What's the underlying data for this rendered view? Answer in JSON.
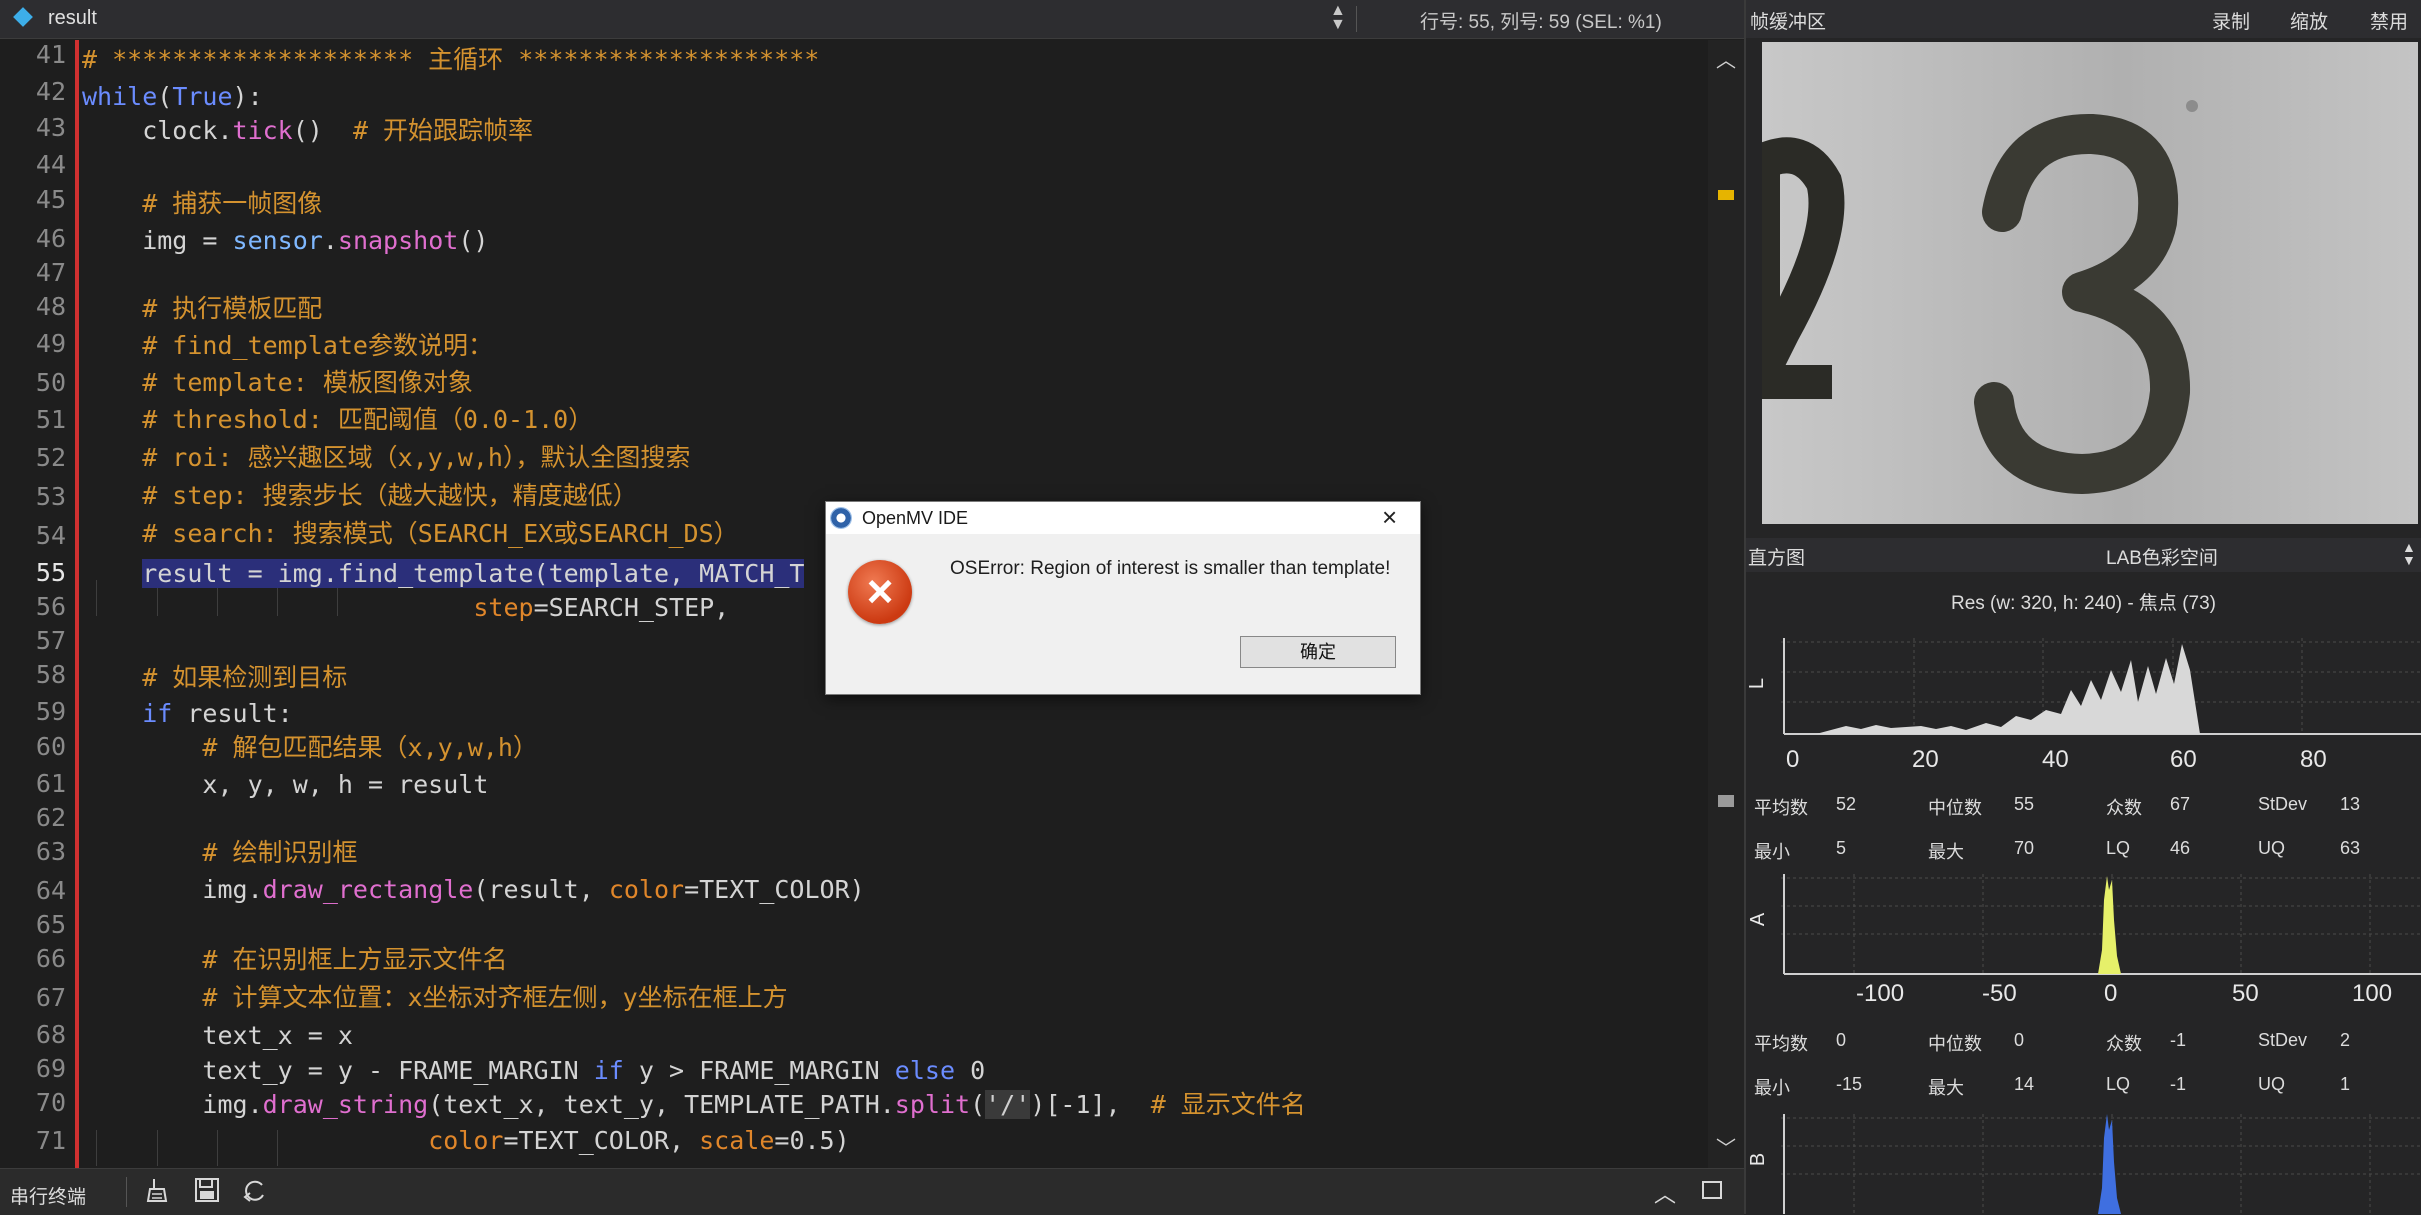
{
  "editor": {
    "tab_name": "result",
    "cursor_info": "行号: 55, 列号: 59   (SEL: %1)",
    "line_numbers": [
      "41",
      "42",
      "43",
      "44",
      "45",
      "46",
      "47",
      "48",
      "49",
      "50",
      "51",
      "52",
      "53",
      "54",
      "55",
      "56",
      "57",
      "58",
      "59",
      "60",
      "61",
      "62",
      "63",
      "64",
      "65",
      "66",
      "67",
      "68",
      "69",
      "70",
      "71"
    ],
    "current_line": "55",
    "lines": {
      "l41": "# ******************** 主循环 ********************",
      "l42_kw": "while",
      "l42_rest": "(",
      "l42_true": "True",
      "l42_end": "):",
      "l43_a": "    clock.",
      "l43_fn": "tick",
      "l43_b": "()  ",
      "l43_cm": "# 开始跟踪帧率",
      "l45": "    # 捕获一帧图像",
      "l46_a": "    img = ",
      "l46_ob": "sensor",
      "l46_dot": ".",
      "l46_fn": "snapshot",
      "l46_b": "()",
      "l48": "    # 执行模板匹配",
      "l49": "    # find_template参数说明：",
      "l50": "    # template: 模板图像对象",
      "l51": "    # threshold: 匹配阈值（0.0-1.0）",
      "l52": "    # roi: 感兴趣区域（x,y,w,h），默认全图搜索",
      "l53": "    # step: 搜索步长（越大越快，精度越低）",
      "l54": "    # search: 搜索模式（SEARCH_EX或SEARCH_DS）",
      "l55_indent": "    ",
      "l55_sel": "result = img.find_template(template, MATCH_T",
      "l56_indent": "                          ",
      "l56_pa": "step",
      "l56_rest": "=SEARCH_STEP,",
      "l58": "    # 如果检测到目标",
      "l59_kw": "if",
      "l59_a": "    ",
      "l59_b": " result:",
      "l60": "        # 解包匹配结果（x,y,w,h）",
      "l61": "        x, y, w, h = result",
      "l63": "        # 绘制识别框",
      "l64_a": "        img.",
      "l64_fn": "draw_rectangle",
      "l64_b": "(result, ",
      "l64_pa": "color",
      "l64_c": "=TEXT_COLOR)",
      "l66": "        # 在识别框上方显示文件名",
      "l67": "        # 计算文本位置：x坐标对齐框左侧，y坐标在框上方",
      "l68": "        text_x = x",
      "l69_a": "        text_y = y - FRAME_MARGIN ",
      "l69_if": "if",
      "l69_b": " y > FRAME_MARGIN ",
      "l69_else": "else",
      "l69_c": " 0",
      "l70_a": "        img.",
      "l70_fn": "draw_string",
      "l70_b": "(text_x, text_y, TEMPLATE_PATH.",
      "l70_fn2": "split",
      "l70_c": "(",
      "l70_st": "'/'",
      "l70_d": ")[-1],  ",
      "l70_cm": "# 显示文件名",
      "l71_indent": "                       ",
      "l71_pa": "color",
      "l71_a": "=TEXT_COLOR, ",
      "l71_pa2": "scale",
      "l71_b": "=0.5)"
    }
  },
  "statusbar": {
    "serial_label": "串行终端",
    "icons": [
      "clear-icon",
      "save-icon",
      "rotate-icon",
      "chevron-up-icon",
      "panel-icon"
    ]
  },
  "framebuffer": {
    "title": "帧缓冲区",
    "record": "录制",
    "zoom": "缩放",
    "disable": "禁用"
  },
  "histogram": {
    "title": "直方图",
    "mode": "LAB色彩空间",
    "res": "Res  (w: 320,  h: 240)  - 焦点  (73)",
    "L": {
      "letter": "L",
      "ticks": [
        "0",
        "20",
        "40",
        "60",
        "80"
      ],
      "stats": {
        "mean_label": "平均数",
        "mean": "52",
        "median_label": "中位数",
        "median": "55",
        "mode_label": "众数",
        "mode": "67",
        "stdev_label": "StDev",
        "stdev": "13",
        "min_label": "最小",
        "min": "5",
        "max_label": "最大",
        "max": "70",
        "lq_label": "LQ",
        "lq": "46",
        "uq_label": "UQ",
        "uq": "63"
      }
    },
    "A": {
      "letter": "A",
      "ticks": [
        "-100",
        "-50",
        "0",
        "50",
        "100"
      ],
      "stats": {
        "mean_label": "平均数",
        "mean": "0",
        "median_label": "中位数",
        "median": "0",
        "mode_label": "众数",
        "mode": "-1",
        "stdev_label": "StDev",
        "stdev": "2",
        "min_label": "最小",
        "min": "-15",
        "max_label": "最大",
        "max": "14",
        "lq_label": "LQ",
        "lq": "-1",
        "uq_label": "UQ",
        "uq": "1"
      }
    },
    "B": {
      "letter": "B"
    }
  },
  "dialog": {
    "title": "OpenMV IDE",
    "message": "OSError: Region of interest is smaller than template!",
    "ok": "确定"
  }
}
